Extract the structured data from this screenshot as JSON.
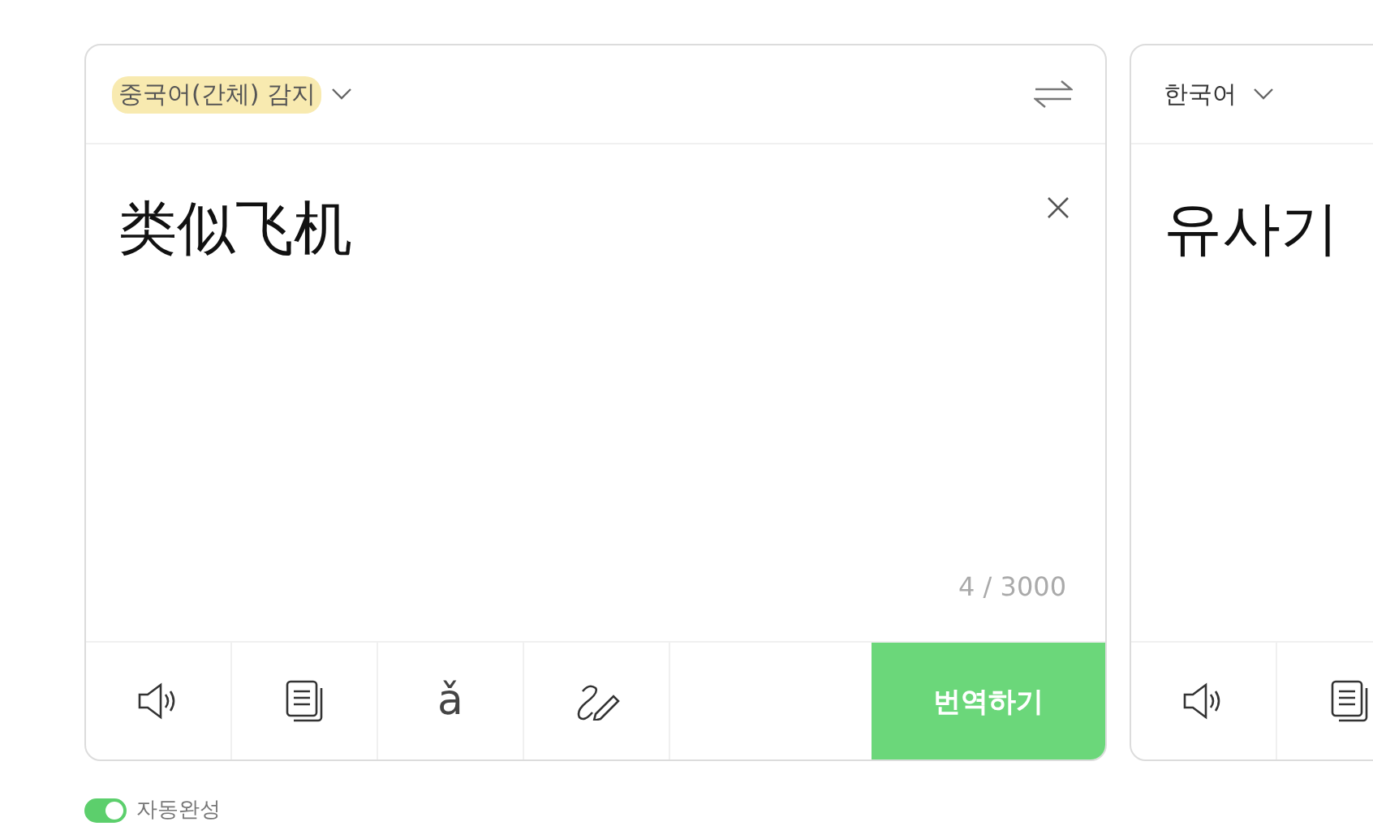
{
  "source": {
    "language": "중국어(간체) 감지",
    "highlighted": true,
    "text": "类似飞机",
    "counter": "4 / 3000",
    "tools": [
      {
        "kind": "speaker"
      },
      {
        "kind": "copy"
      },
      {
        "kind": "pinyin",
        "label": "ǎ"
      },
      {
        "kind": "handwriting"
      }
    ],
    "submit": "번역하기"
  },
  "target": {
    "language": "한국어",
    "text": "유사기",
    "tools": [
      {
        "kind": "speaker"
      },
      {
        "kind": "copy"
      }
    ]
  },
  "autocomplete": {
    "label": "자동완성",
    "on": true
  }
}
